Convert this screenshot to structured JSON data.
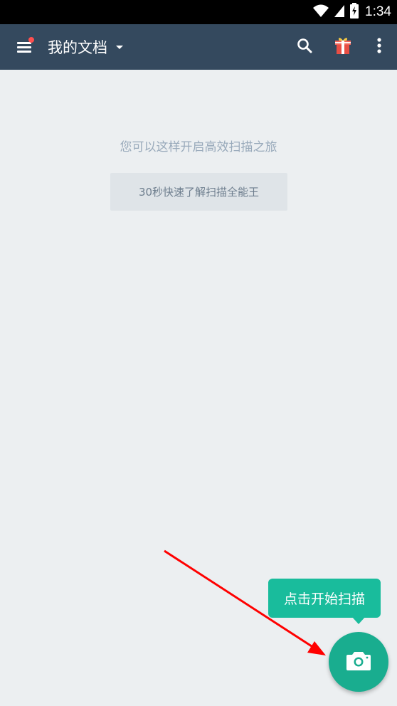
{
  "status_bar": {
    "time": "1:34",
    "icons": [
      "wifi-icon",
      "signal-icon",
      "battery-charging-icon"
    ]
  },
  "app_bar": {
    "title": "我的文档",
    "menu_icon": "menu-icon",
    "has_notification_dot": true,
    "actions": [
      "search-icon",
      "gift-icon",
      "more-vert-icon"
    ]
  },
  "empty_state": {
    "hint": "您可以这样开启高效扫描之旅",
    "guide_button_label": "30秒快速了解扫描全能王"
  },
  "tooltip": {
    "label": "点击开始扫描"
  },
  "fab": {
    "icon": "camera-icon"
  },
  "colors": {
    "app_bar": "#34495e",
    "background": "#eceff1",
    "accent": "#19bc9c",
    "fab": "#19ad8f",
    "notification_dot": "#ff4f4f",
    "annotation_arrow": "#ff0000"
  }
}
